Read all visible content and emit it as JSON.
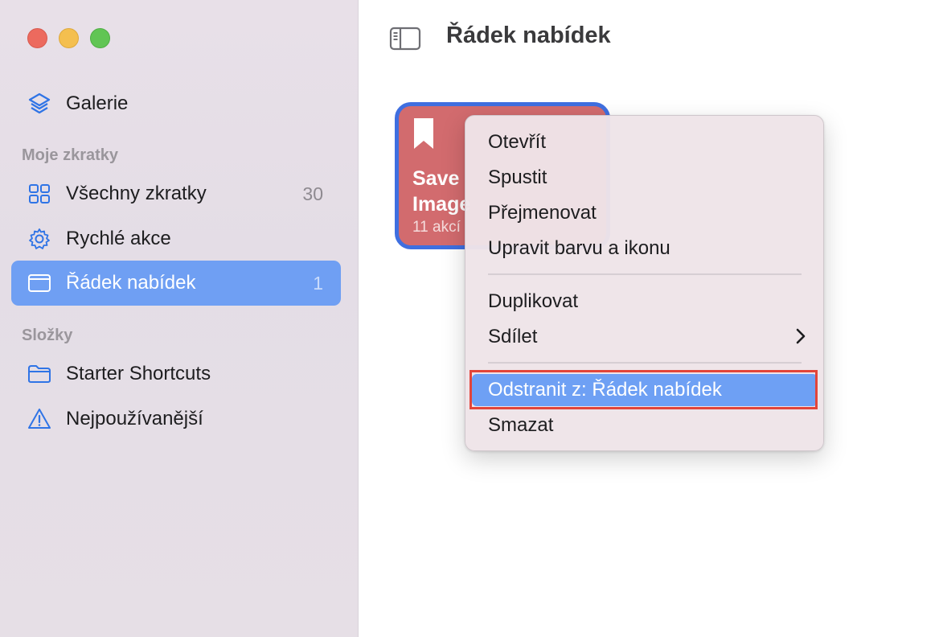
{
  "window": {
    "title": "Řádek nabídek"
  },
  "sidebar": {
    "gallery_label": "Galerie",
    "section_my": "Moje zkratky",
    "items": [
      {
        "label": "Všechny zkratky",
        "count": "30",
        "icon": "grid-icon"
      },
      {
        "label": "Rychlé akce",
        "count": "",
        "icon": "gear-icon"
      },
      {
        "label": "Řádek nabídek",
        "count": "1",
        "icon": "menubar-icon"
      }
    ],
    "section_folders": "Složky",
    "folders": [
      {
        "label": "Starter Shortcuts",
        "icon": "folder-icon"
      },
      {
        "label": "Nejpoužívanější",
        "icon": "warning-icon"
      }
    ]
  },
  "shortcut_tile": {
    "line1": "Save",
    "line2": "Image",
    "subtitle": "11 akcí",
    "color": "#d26b6e"
  },
  "context_menu": {
    "group1": [
      "Otevřít",
      "Spustit",
      "Přejmenovat",
      "Upravit barvu a ikonu"
    ],
    "group2": [
      "Duplikovat",
      "Sdílet"
    ],
    "group3": [
      "Odstranit z: Řádek nabídek",
      "Smazat"
    ]
  },
  "colors": {
    "accent": "#6f9ff3",
    "highlight_border": "#e2453a"
  }
}
